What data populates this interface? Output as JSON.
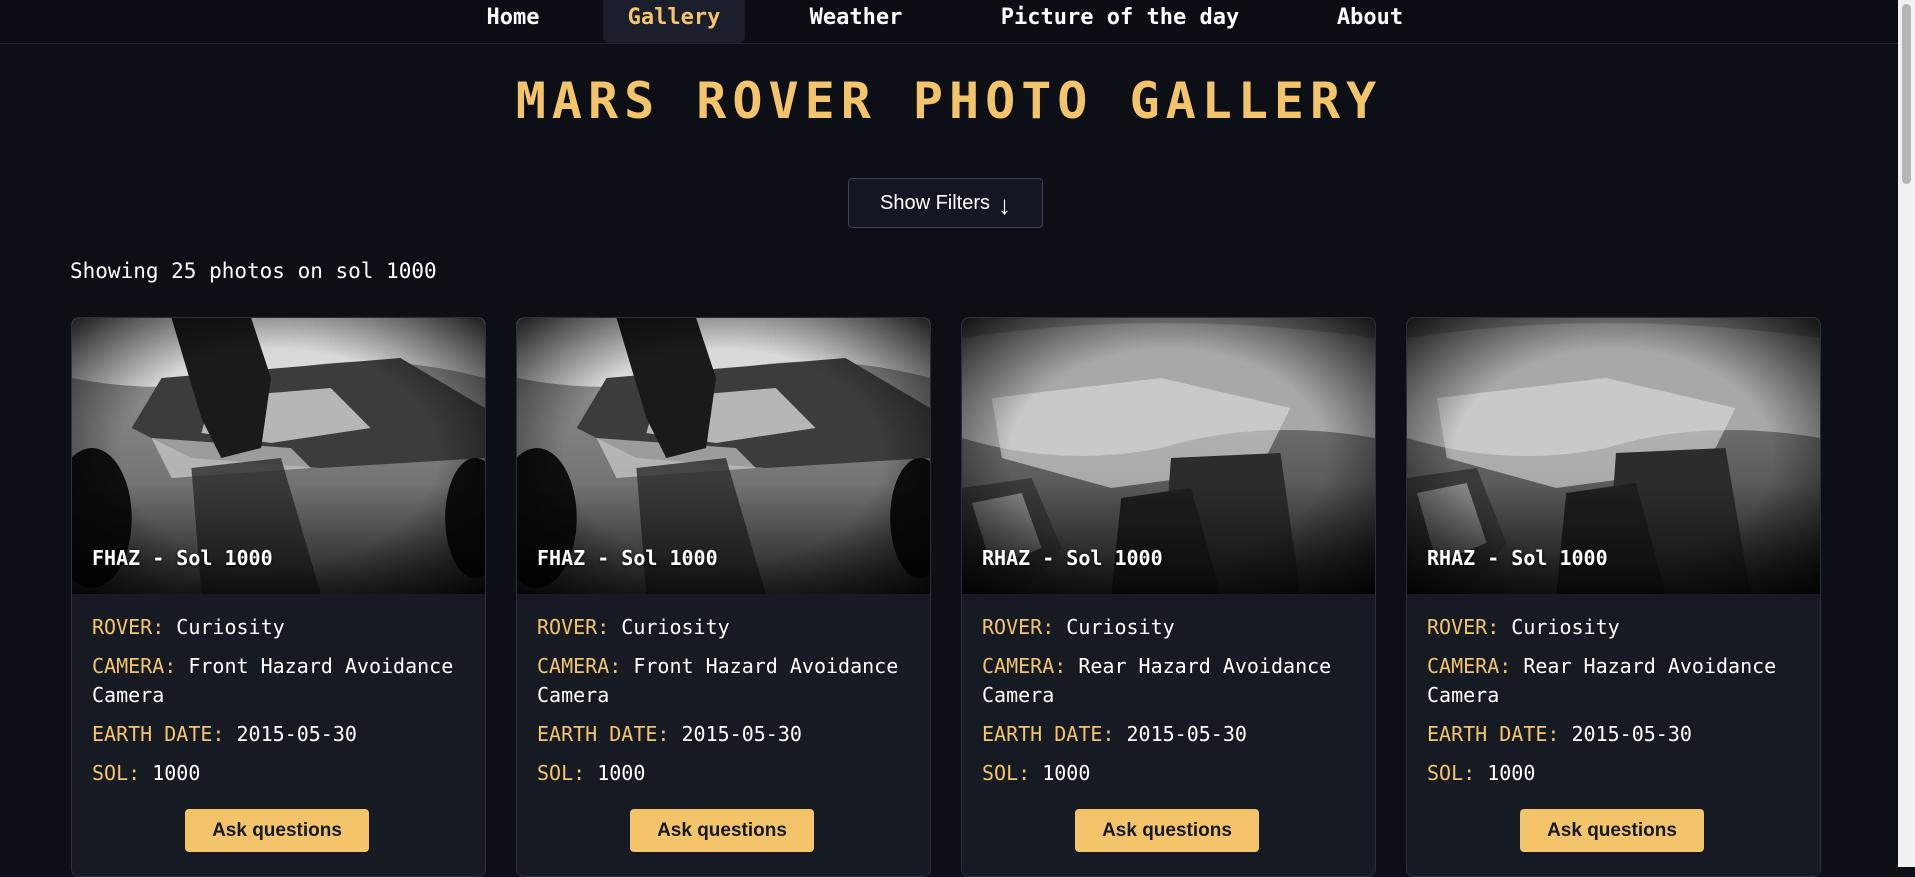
{
  "nav": {
    "items": [
      {
        "label": "Home"
      },
      {
        "label": "Gallery",
        "active": true
      },
      {
        "label": "Weather"
      },
      {
        "label": "Picture of the day"
      },
      {
        "label": "About"
      }
    ]
  },
  "page": {
    "title": "MARS ROVER PHOTO GALLERY",
    "filter_button_label": "Show Filters",
    "filter_button_icon": "↓",
    "count_text": "Showing 25 photos on sol 1000"
  },
  "labels": {
    "rover": "ROVER:",
    "camera": "CAMERA:",
    "earth_date": "EARTH DATE:",
    "sol": "SOL:",
    "ask": "Ask questions"
  },
  "cards": [
    {
      "caption": "FHAZ - Sol 1000",
      "rover": "Curiosity",
      "camera": "Front Hazard Avoidance Camera",
      "earth_date": "2015-05-30",
      "sol": "1000"
    },
    {
      "caption": "FHAZ - Sol 1000",
      "rover": "Curiosity",
      "camera": "Front Hazard Avoidance Camera",
      "earth_date": "2015-05-30",
      "sol": "1000"
    },
    {
      "caption": "RHAZ - Sol 1000",
      "rover": "Curiosity",
      "camera": "Rear Hazard Avoidance Camera",
      "earth_date": "2015-05-30",
      "sol": "1000"
    },
    {
      "caption": "RHAZ - Sol 1000",
      "rover": "Curiosity",
      "camera": "Rear Hazard Avoidance Camera",
      "earth_date": "2015-05-30",
      "sol": "1000"
    }
  ],
  "colors": {
    "accent": "#f4c46b",
    "background": "#0c0f16",
    "card": "#161a23"
  }
}
